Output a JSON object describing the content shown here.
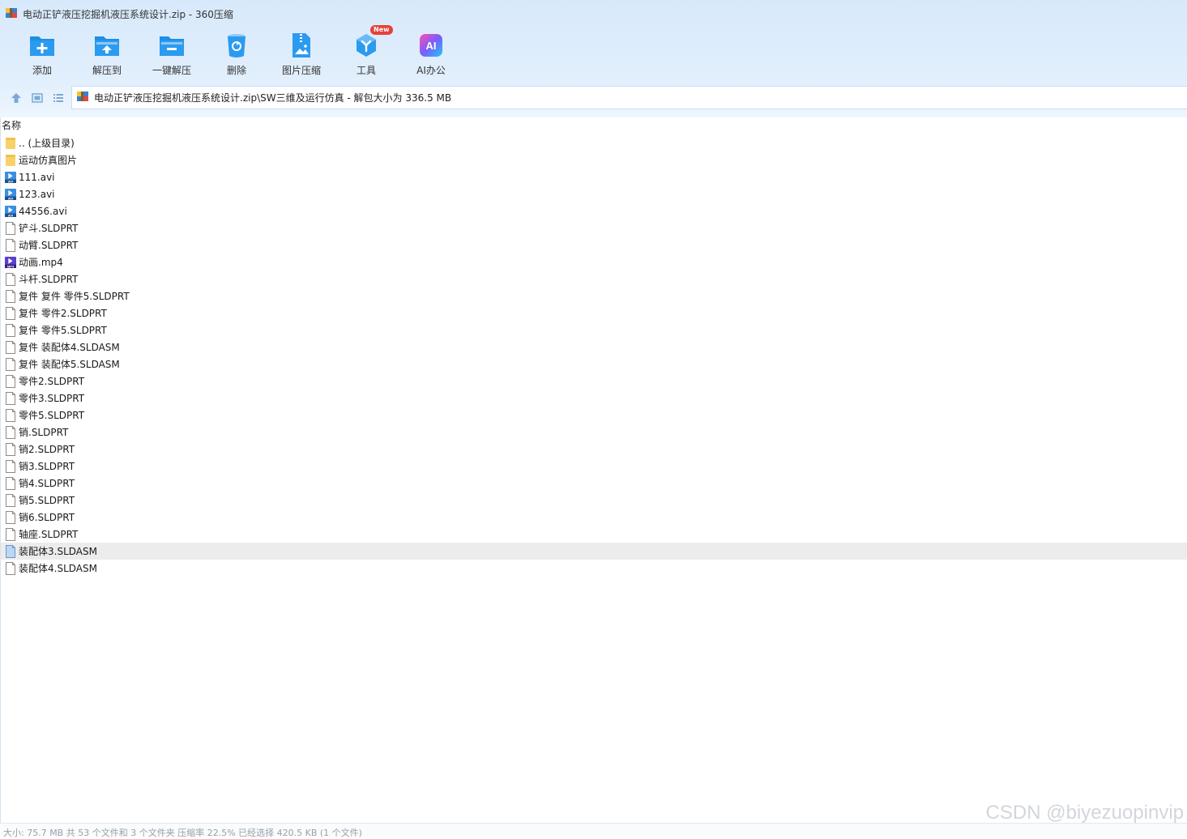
{
  "window": {
    "title": "电动正铲液压挖掘机液压系统设计.zip - 360压缩"
  },
  "toolbar": {
    "buttons": [
      {
        "label": "添加",
        "icon": "folder-add-icon"
      },
      {
        "label": "解压到",
        "icon": "folder-extract-icon"
      },
      {
        "label": "一键解压",
        "icon": "folder-quick-extract-icon"
      },
      {
        "label": "删除",
        "icon": "trash-icon"
      },
      {
        "label": "图片压缩",
        "icon": "image-compress-icon"
      },
      {
        "label": "工具",
        "icon": "tools-icon",
        "badge": "New"
      },
      {
        "label": "AI办公",
        "icon": "ai-office-icon",
        "glyph": "AI"
      }
    ]
  },
  "address": {
    "path": "电动正铲液压挖掘机液压系统设计.zip\\SW三维及运行仿真 - 解包大小为 336.5 MB"
  },
  "list": {
    "column_name": "名称",
    "items": [
      {
        "name": ".. (上级目录)",
        "type": "folder"
      },
      {
        "name": "运动仿真图片",
        "type": "folder"
      },
      {
        "name": "111.avi",
        "type": "avi"
      },
      {
        "name": "123.avi",
        "type": "avi"
      },
      {
        "name": "44556.avi",
        "type": "avi"
      },
      {
        "name": "铲斗.SLDPRT",
        "type": "file"
      },
      {
        "name": "动臂.SLDPRT",
        "type": "file"
      },
      {
        "name": "动画.mp4",
        "type": "mp4"
      },
      {
        "name": "斗杆.SLDPRT",
        "type": "file"
      },
      {
        "name": "复件 复件 零件5.SLDPRT",
        "type": "file"
      },
      {
        "name": "复件 零件2.SLDPRT",
        "type": "file"
      },
      {
        "name": "复件 零件5.SLDPRT",
        "type": "file"
      },
      {
        "name": "复件 装配体4.SLDASM",
        "type": "file"
      },
      {
        "name": "复件 装配体5.SLDASM",
        "type": "file"
      },
      {
        "name": "零件2.SLDPRT",
        "type": "file"
      },
      {
        "name": "零件3.SLDPRT",
        "type": "file"
      },
      {
        "name": "零件5.SLDPRT",
        "type": "file"
      },
      {
        "name": "销.SLDPRT",
        "type": "file"
      },
      {
        "name": "销2.SLDPRT",
        "type": "file"
      },
      {
        "name": "销3.SLDPRT",
        "type": "file"
      },
      {
        "name": "销4.SLDPRT",
        "type": "file"
      },
      {
        "name": "销5.SLDPRT",
        "type": "file"
      },
      {
        "name": "销6.SLDPRT",
        "type": "file"
      },
      {
        "name": "轴座.SLDPRT",
        "type": "file"
      },
      {
        "name": "装配体3.SLDASM",
        "type": "file",
        "selected": true
      },
      {
        "name": "装配体4.SLDASM",
        "type": "file"
      }
    ]
  },
  "status": {
    "text": "大小: 75.7 MB 共 53 个文件和 3 个文件夹 压缩率 22.5% 已经选择 420.5 KB (1 个文件)"
  },
  "watermark": "CSDN @biyezuopinvip",
  "colors": {
    "accent": "#2f8ee8",
    "folder": "#f7d26a",
    "selected_row": "#ececec"
  }
}
